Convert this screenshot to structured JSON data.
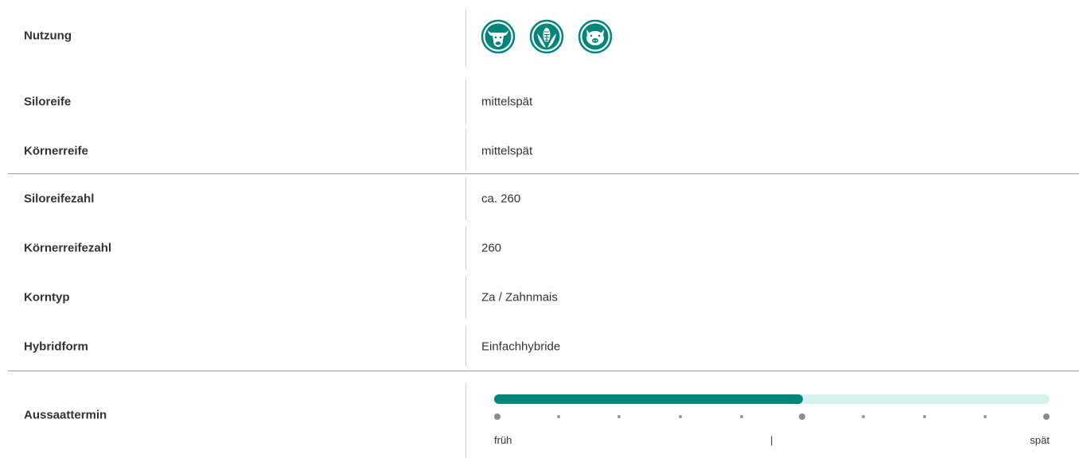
{
  "rows": [
    {
      "label": "Nutzung",
      "value": ""
    },
    {
      "label": "Siloreife",
      "value": "mittelspät"
    },
    {
      "label": "Körnerreife",
      "value": "mittelspät"
    },
    {
      "label": "Siloreifezahl",
      "value": "ca. 260"
    },
    {
      "label": "Körnerreifezahl",
      "value": "260"
    },
    {
      "label": "Korntyp",
      "value": "Za / Zahnmais"
    },
    {
      "label": "Hybridform",
      "value": "Einfachhybride"
    },
    {
      "label": "Aussaattermin",
      "value": ""
    }
  ],
  "usage_icons": [
    {
      "name": "cow-icon"
    },
    {
      "name": "corn-icon"
    },
    {
      "name": "pig-icon"
    }
  ],
  "aussaat": {
    "fill_fraction": 0.556,
    "steps": 10,
    "major_steps": [
      0,
      5,
      9
    ],
    "start_label": "früh",
    "mid_label": "|",
    "end_label": "spät"
  },
  "colors": {
    "accent": "#00857a",
    "track": "#d8f0ee",
    "divider": "#9a9a9a"
  }
}
